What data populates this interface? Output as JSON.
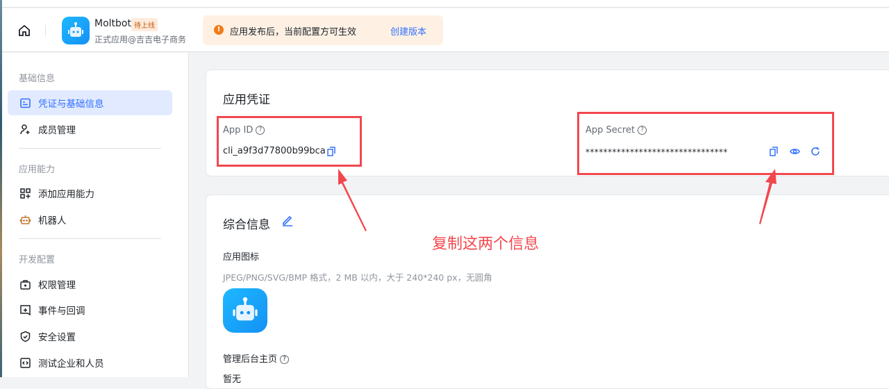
{
  "header": {
    "app_name": "Moltbot",
    "status_badge": "待上线",
    "app_subtitle": "正式应用@吉吉电子商务",
    "notice_text": "应用发布后，当前配置方可生效",
    "notice_link": "创建版本"
  },
  "sidebar": {
    "sections": [
      {
        "title": "基础信息",
        "items": [
          {
            "label": "凭证与基础信息",
            "icon": "id-card-icon",
            "active": true
          },
          {
            "label": "成员管理",
            "icon": "user-add-icon"
          }
        ]
      },
      {
        "title": "应用能力",
        "items": [
          {
            "label": "添加应用能力",
            "icon": "apps-add-icon"
          },
          {
            "label": "机器人",
            "icon": "robot-icon"
          }
        ]
      },
      {
        "title": "开发配置",
        "items": [
          {
            "label": "权限管理",
            "icon": "permission-icon"
          },
          {
            "label": "事件与回调",
            "icon": "event-icon"
          },
          {
            "label": "安全设置",
            "icon": "shield-icon"
          },
          {
            "label": "测试企业和人员",
            "icon": "code-icon"
          }
        ]
      }
    ]
  },
  "credentials": {
    "title": "应用凭证",
    "app_id_label": "App ID",
    "app_id": "cli_a9f3d77800b99bca",
    "app_secret_label": "App Secret",
    "app_secret": "********************************"
  },
  "general": {
    "title": "综合信息",
    "icon_label": "应用图标",
    "icon_hint": "JPEG/PNG/SVG/BMP 格式，2 MB 以内，大于 240*240 px，无圆角",
    "admin_home_label": "管理后台主页",
    "admin_home_value": "暂无"
  },
  "annotation": {
    "text": "复制这两个信息",
    "color": "#f2484d"
  },
  "colors": {
    "accent": "#3370ff",
    "warning": "#f07d1a"
  }
}
